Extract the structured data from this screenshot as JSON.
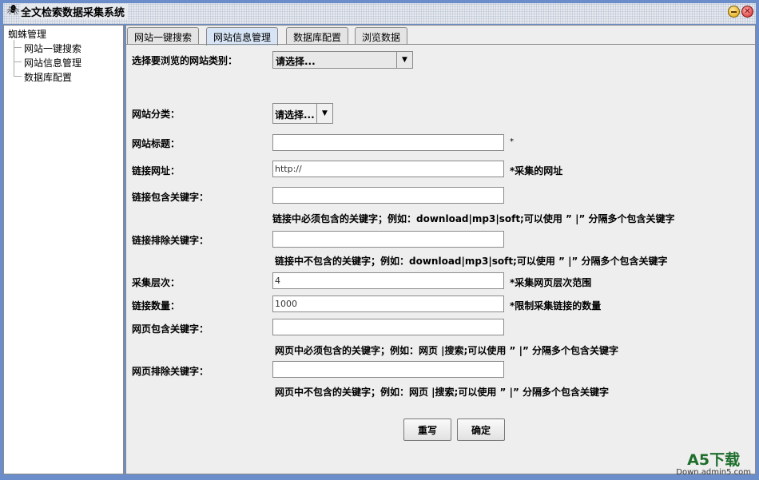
{
  "window": {
    "title": "全文检索数据采集系统",
    "minimize_icon": "minimize-icon",
    "close_icon": "close-icon"
  },
  "tree": {
    "root": "蜘蛛管理",
    "items": [
      "网站一键搜索",
      "网站信息管理",
      "数据库配置"
    ]
  },
  "tabs": [
    {
      "label": "网站一键搜索"
    },
    {
      "label": "网站信息管理",
      "active": true
    },
    {
      "label": "数据库配置"
    },
    {
      "label": "浏览数据"
    }
  ],
  "form": {
    "browse_category_label": "选择要浏览的网站类别：",
    "browse_category_value": "请选择...",
    "category_label": "网站分类：",
    "category_value": "请选择...",
    "title_label": "网站标题：",
    "title_value": "",
    "title_note": "*",
    "url_label": "链接网址：",
    "url_value": "http://",
    "url_note": "*采集的网址",
    "link_include_label": "链接包含关键字：",
    "link_include_value": "",
    "link_include_hint": "链接中必须包含的关键字；例如：download|mp3|soft;可以使用 ” |” 分隔多个包含关键字",
    "link_exclude_label": "链接排除关键字：",
    "link_exclude_value": "",
    "link_exclude_hint": "链接中不包含的关键字；例如：download|mp3|soft;可以使用 ” |” 分隔多个包含关键字",
    "depth_label": "采集层次：",
    "depth_value": "4",
    "depth_note": "*采集网页层次范围",
    "link_count_label": "链接数量：",
    "link_count_value": "1000",
    "link_count_note": "*限制采集链接的数量",
    "page_include_label": "网页包含关键字：",
    "page_include_value": "",
    "page_include_hint": "网页中必须包含的关键字；例如：网页 |搜索;可以使用 ” |” 分隔多个包含关键字",
    "page_exclude_label": "网页排除关键字：",
    "page_exclude_value": "",
    "page_exclude_hint": "网页中不包含的关键字；例如：网页 |搜索;可以使用 ” |” 分隔多个包含关键字",
    "reset_button": "重写",
    "confirm_button": "确定"
  },
  "watermark": {
    "logo": "A5下载",
    "site": "Down.admin5.com"
  }
}
